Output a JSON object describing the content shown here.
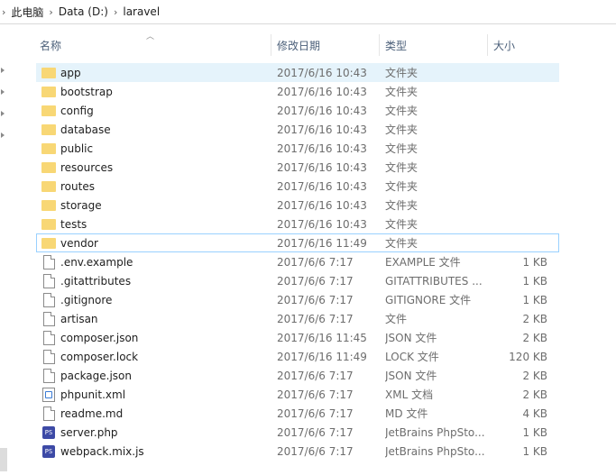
{
  "address_bar": {
    "crumbs": [
      "此电脑",
      "Data (D:)",
      "laravel"
    ]
  },
  "columns": {
    "name": "名称",
    "date": "修改日期",
    "type": "类型",
    "size": "大小"
  },
  "files": [
    {
      "name": "app",
      "date": "2017/6/16 10:43",
      "type": "文件夹",
      "size": "",
      "icon": "folder-icon"
    },
    {
      "name": "bootstrap",
      "date": "2017/6/16 10:43",
      "type": "文件夹",
      "size": "",
      "icon": "folder-icon"
    },
    {
      "name": "config",
      "date": "2017/6/16 10:43",
      "type": "文件夹",
      "size": "",
      "icon": "folder-icon"
    },
    {
      "name": "database",
      "date": "2017/6/16 10:43",
      "type": "文件夹",
      "size": "",
      "icon": "folder-icon"
    },
    {
      "name": "public",
      "date": "2017/6/16 10:43",
      "type": "文件夹",
      "size": "",
      "icon": "folder-icon"
    },
    {
      "name": "resources",
      "date": "2017/6/16 10:43",
      "type": "文件夹",
      "size": "",
      "icon": "folder-icon"
    },
    {
      "name": "routes",
      "date": "2017/6/16 10:43",
      "type": "文件夹",
      "size": "",
      "icon": "folder-icon"
    },
    {
      "name": "storage",
      "date": "2017/6/16 10:43",
      "type": "文件夹",
      "size": "",
      "icon": "folder-icon"
    },
    {
      "name": "tests",
      "date": "2017/6/16 10:43",
      "type": "文件夹",
      "size": "",
      "icon": "folder-icon"
    },
    {
      "name": "vendor",
      "date": "2017/6/16 11:49",
      "type": "文件夹",
      "size": "",
      "icon": "folder-icon"
    },
    {
      "name": ".env.example",
      "date": "2017/6/6 7:17",
      "type": "EXAMPLE 文件",
      "size": "1 KB",
      "icon": "file-icon"
    },
    {
      "name": ".gitattributes",
      "date": "2017/6/6 7:17",
      "type": "GITATTRIBUTES ...",
      "size": "1 KB",
      "icon": "file-icon"
    },
    {
      "name": ".gitignore",
      "date": "2017/6/6 7:17",
      "type": "GITIGNORE 文件",
      "size": "1 KB",
      "icon": "file-icon"
    },
    {
      "name": "artisan",
      "date": "2017/6/6 7:17",
      "type": "文件",
      "size": "2 KB",
      "icon": "file-icon"
    },
    {
      "name": "composer.json",
      "date": "2017/6/16 11:45",
      "type": "JSON 文件",
      "size": "2 KB",
      "icon": "file-icon"
    },
    {
      "name": "composer.lock",
      "date": "2017/6/16 11:49",
      "type": "LOCK 文件",
      "size": "120 KB",
      "icon": "file-icon"
    },
    {
      "name": "package.json",
      "date": "2017/6/6 7:17",
      "type": "JSON 文件",
      "size": "2 KB",
      "icon": "file-icon"
    },
    {
      "name": "phpunit.xml",
      "date": "2017/6/6 7:17",
      "type": "XML 文档",
      "size": "2 KB",
      "icon": "xml-icon"
    },
    {
      "name": "readme.md",
      "date": "2017/6/6 7:17",
      "type": "MD 文件",
      "size": "4 KB",
      "icon": "file-icon"
    },
    {
      "name": "server.php",
      "date": "2017/6/6 7:17",
      "type": "JetBrains PhpSto...",
      "size": "1 KB",
      "icon": "php-icon"
    },
    {
      "name": "webpack.mix.js",
      "date": "2017/6/6 7:17",
      "type": "JetBrains PhpSto...",
      "size": "1 KB",
      "icon": "php-icon"
    }
  ],
  "colors": {
    "selected_row": "#e5f3fb",
    "focus_border": "#99d1ff",
    "folder": "#f8d775",
    "header_text": "#4c607a"
  }
}
